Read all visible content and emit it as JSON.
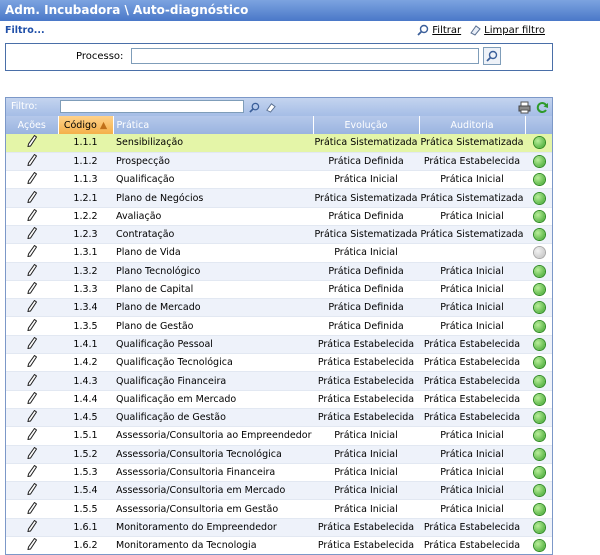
{
  "window": {
    "title": "Adm. Incubadora \\ Auto-diagnóstico"
  },
  "filter": {
    "toggle_label": "Filtro...",
    "apply_label": "Filtrar",
    "clear_label": "Limpar filtro"
  },
  "process": {
    "label": "Processo:",
    "value": ""
  },
  "grid": {
    "filter_label": "Filtro:",
    "filter_value": "",
    "columns": [
      "Ações",
      "Código",
      "Prática",
      "Evolução",
      "Auditoria",
      ""
    ],
    "sorted_column": "Código",
    "rows": [
      {
        "code": "1.1.1",
        "pratica": "Sensibilização",
        "evolucao": "Prática Sistematizada",
        "auditoria": "Prática Sistematizada",
        "status": "green",
        "highlighted": true
      },
      {
        "code": "1.1.2",
        "pratica": "Prospecção",
        "evolucao": "Prática Definida",
        "auditoria": "Prática Estabelecida",
        "status": "green"
      },
      {
        "code": "1.1.3",
        "pratica": "Qualificação",
        "evolucao": "Prática Inicial",
        "auditoria": "Prática Inicial",
        "status": "green"
      },
      {
        "code": "1.2.1",
        "pratica": "Plano de Negócios",
        "evolucao": "Prática Sistematizada",
        "auditoria": "Prática Sistematizada",
        "status": "green"
      },
      {
        "code": "1.2.2",
        "pratica": "Avaliação",
        "evolucao": "Prática Definida",
        "auditoria": "Prática Inicial",
        "status": "green"
      },
      {
        "code": "1.2.3",
        "pratica": "Contratação",
        "evolucao": "Prática Sistematizada",
        "auditoria": "Prática Sistematizada",
        "status": "green"
      },
      {
        "code": "1.3.1",
        "pratica": "Plano de Vida",
        "evolucao": "Prática Inicial",
        "auditoria": "",
        "status": "gray"
      },
      {
        "code": "1.3.2",
        "pratica": "Plano Tecnológico",
        "evolucao": "Prática Definida",
        "auditoria": "Prática Inicial",
        "status": "green"
      },
      {
        "code": "1.3.3",
        "pratica": "Plano de Capital",
        "evolucao": "Prática Definida",
        "auditoria": "Prática Inicial",
        "status": "green"
      },
      {
        "code": "1.3.4",
        "pratica": "Plano de Mercado",
        "evolucao": "Prática Definida",
        "auditoria": "Prática Inicial",
        "status": "green"
      },
      {
        "code": "1.3.5",
        "pratica": "Plano de Gestão",
        "evolucao": "Prática Definida",
        "auditoria": "Prática Inicial",
        "status": "green"
      },
      {
        "code": "1.4.1",
        "pratica": "Qualificação Pessoal",
        "evolucao": "Prática Estabelecida",
        "auditoria": "Prática Estabelecida",
        "status": "green"
      },
      {
        "code": "1.4.2",
        "pratica": "Qualificação Tecnológica",
        "evolucao": "Prática Estabelecida",
        "auditoria": "Prática Estabelecida",
        "status": "green"
      },
      {
        "code": "1.4.3",
        "pratica": "Qualificação Financeira",
        "evolucao": "Prática Estabelecida",
        "auditoria": "Prática Estabelecida",
        "status": "green"
      },
      {
        "code": "1.4.4",
        "pratica": "Qualificação em Mercado",
        "evolucao": "Prática Estabelecida",
        "auditoria": "Prática Estabelecida",
        "status": "green"
      },
      {
        "code": "1.4.5",
        "pratica": "Qualificação de Gestão",
        "evolucao": "Prática Estabelecida",
        "auditoria": "Prática Estabelecida",
        "status": "green"
      },
      {
        "code": "1.5.1",
        "pratica": "Assessoria/Consultoria ao Empreendedor",
        "evolucao": "Prática Inicial",
        "auditoria": "Prática Inicial",
        "status": "green"
      },
      {
        "code": "1.5.2",
        "pratica": "Assessoria/Consultoria Tecnológica",
        "evolucao": "Prática Inicial",
        "auditoria": "Prática Inicial",
        "status": "green"
      },
      {
        "code": "1.5.3",
        "pratica": "Assessoria/Consultoria Financeira",
        "evolucao": "Prática Inicial",
        "auditoria": "Prática Inicial",
        "status": "green"
      },
      {
        "code": "1.5.4",
        "pratica": "Assessoria/Consultoria em Mercado",
        "evolucao": "Prática Inicial",
        "auditoria": "Prática Inicial",
        "status": "green"
      },
      {
        "code": "1.5.5",
        "pratica": "Assessoria/Consultoria em Gestão",
        "evolucao": "Prática Inicial",
        "auditoria": "Prática Inicial",
        "status": "green"
      },
      {
        "code": "1.6.1",
        "pratica": "Monitoramento do Empreendedor",
        "evolucao": "Prática Estabelecida",
        "auditoria": "Prática Estabelecida",
        "status": "green"
      },
      {
        "code": "1.6.2",
        "pratica": "Monitoramento da Tecnologia",
        "evolucao": "Prática Estabelecida",
        "auditoria": "Prática Estabelecida",
        "status": "green"
      }
    ]
  },
  "icons": {
    "filter": "magnifier-icon",
    "clear": "eraser-icon",
    "print": "printer-icon",
    "refresh": "refresh-icon",
    "edit": "pencil-icon",
    "status": "status-dot-icon"
  },
  "colors": {
    "title_bar": "#4a78c8",
    "highlight_row": "#e4f5a8",
    "sorted_header": "#f4b04a",
    "status_green": "#3aa32a",
    "status_gray": "#bdbdbd"
  }
}
